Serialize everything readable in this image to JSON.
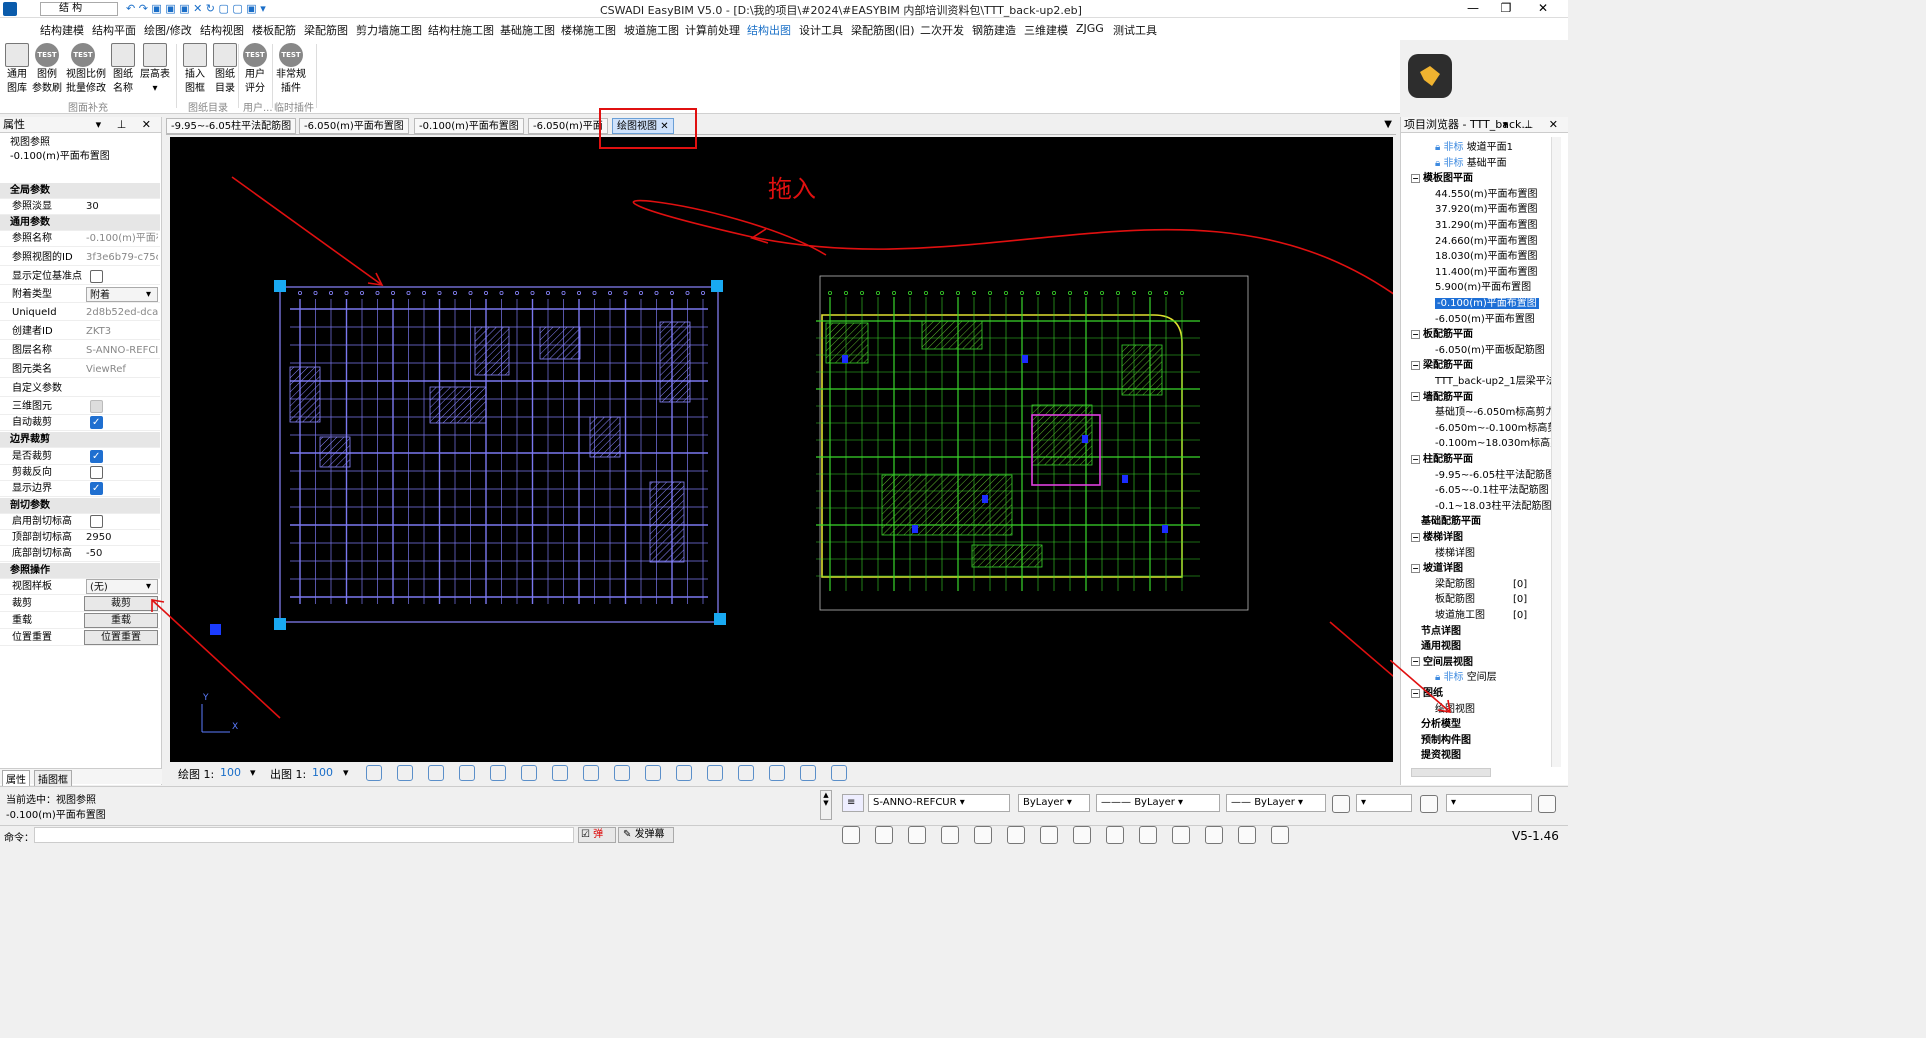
{
  "title_bar": {
    "workspace": "结 构",
    "title": "CSWADI EasyBIM V5.0 - [D:\\我的项目\\#2024\\#EASYBIM 内部培训资料包\\TTT_back-up2.eb]"
  },
  "menu": [
    "结构建模",
    "结构平面",
    "绘图/修改",
    "结构视图",
    "楼板配筋",
    "梁配筋图",
    "剪力墙施工图",
    "结构柱施工图",
    "基础施工图",
    "楼梯施工图",
    "坡道施工图",
    "计算前处理",
    "结构出图",
    "设计工具",
    "梁配筋图(旧)",
    "二次开发",
    "钢筋建造",
    "三维建模",
    "ZJGG",
    "测试工具"
  ],
  "menu_active": "结构出图",
  "ribbon": {
    "buttons": [
      {
        "l1": "通用",
        "l2": "图库"
      },
      {
        "l1": "图例",
        "l2": "参数刷",
        "icon": "TEST"
      },
      {
        "l1": "视图比例",
        "l2": "批量修改",
        "icon": "TEST"
      },
      {
        "l1": "图纸",
        "l2": "名称"
      },
      {
        "l1": "层高表",
        "l2": "▾"
      },
      {
        "l1": "插入",
        "l2": "图框"
      },
      {
        "l1": "图纸",
        "l2": "目录"
      },
      {
        "l1": "用户",
        "l2": "评分",
        "icon": "TEST"
      },
      {
        "l1": "非常规",
        "l2": "插件",
        "icon": "TEST"
      }
    ],
    "groups": [
      "图面补充",
      "图纸目录",
      "用户...",
      "临时插件"
    ]
  },
  "properties": {
    "header": "属性",
    "type_label": "视图参照",
    "type_value": "-0.100(m)平面布置图",
    "rows": [
      {
        "kind": "section",
        "k": "全局参数"
      },
      {
        "k": "参照淡显",
        "v": "30",
        "dark": true
      },
      {
        "kind": "section",
        "k": "通用参数"
      },
      {
        "k": "参照名称",
        "v": "-0.100(m)平面布"
      },
      {
        "k": "参照视图的ID",
        "v": "3f3e6b79-c75c"
      },
      {
        "k": "显示定位基准点",
        "cb": "off"
      },
      {
        "k": "附着类型",
        "v": "附着",
        "dark": true,
        "combo": true
      },
      {
        "k": "UniqueId",
        "v": "2d8b52ed-dca"
      },
      {
        "k": "创建者ID",
        "v": "ZKT3"
      },
      {
        "k": "图层名称",
        "v": "S-ANNO-REFCI"
      },
      {
        "k": "图元类名",
        "v": "ViewRef"
      },
      {
        "k": "自定义参数",
        "v": ""
      },
      {
        "k": "三维图元",
        "cb": "dis"
      },
      {
        "k": "自动裁剪",
        "cb": "on"
      },
      {
        "kind": "section",
        "k": "边界裁剪"
      },
      {
        "k": "是否裁剪",
        "cb": "on"
      },
      {
        "k": "剪裁反向",
        "cb": "off"
      },
      {
        "k": "显示边界",
        "cb": "on"
      },
      {
        "kind": "section",
        "k": "剖切参数"
      },
      {
        "k": "启用剖切标高",
        "cb": "off"
      },
      {
        "k": "顶部剖切标高",
        "v": "2950",
        "dark": true
      },
      {
        "k": "底部剖切标高",
        "v": "-50",
        "dark": true
      },
      {
        "kind": "section",
        "k": "参照操作"
      },
      {
        "k": "视图样板",
        "v": "(无)",
        "dark": true,
        "combo": true
      },
      {
        "k": "裁剪",
        "btn": "裁剪"
      },
      {
        "k": "重载",
        "btn": "重载"
      },
      {
        "k": "位置重置",
        "btn": "位置重置"
      }
    ],
    "tabs": [
      "属性",
      "插图框"
    ]
  },
  "doc_tabs": [
    "-9.95~-6.05柱平法配筋图",
    "-6.050(m)平面布置图",
    "-0.100(m)平面布置图",
    "-6.050(m)平面",
    "绘图视图"
  ],
  "doc_tab_active": "绘图视图",
  "annotation": "拖入",
  "axis": {
    "y": "Y",
    "x": "X"
  },
  "canvas_status": {
    "draw_label": "绘图 1:",
    "draw_scale": "100",
    "out_label": "出图 1:",
    "out_scale": "100"
  },
  "browser": {
    "header": "项目浏览器 - TTT_back...",
    "items": [
      {
        "t": "坡道平面1",
        "lock": "非标",
        "indent": 2
      },
      {
        "t": "基础平面",
        "lock": "非标",
        "indent": 2
      },
      {
        "t": "模板图平面",
        "bold": true,
        "indent": 0
      },
      {
        "t": "44.550(m)平面布置图",
        "indent": 2
      },
      {
        "t": "37.920(m)平面布置图",
        "indent": 2
      },
      {
        "t": "31.290(m)平面布置图",
        "indent": 2
      },
      {
        "t": "24.660(m)平面布置图",
        "indent": 2
      },
      {
        "t": "18.030(m)平面布置图",
        "indent": 2
      },
      {
        "t": "11.400(m)平面布置图",
        "indent": 2
      },
      {
        "t": "5.900(m)平面布置图",
        "indent": 2
      },
      {
        "t": "-0.100(m)平面布置图",
        "indent": 2,
        "sel": true
      },
      {
        "t": "-6.050(m)平面布置图",
        "indent": 2
      },
      {
        "t": "板配筋平面",
        "bold": true,
        "indent": 0
      },
      {
        "t": "-6.050(m)平面板配筋图",
        "indent": 2
      },
      {
        "t": "梁配筋平面",
        "bold": true,
        "indent": 0
      },
      {
        "t": "TTT_back-up2_1层梁平法",
        "indent": 2
      },
      {
        "t": "墙配筋平面",
        "bold": true,
        "indent": 0
      },
      {
        "t": "基础顶~-6.050m标高剪力",
        "indent": 2
      },
      {
        "t": "-6.050m~-0.100m标高剪",
        "indent": 2
      },
      {
        "t": "-0.100m~18.030m标高剪",
        "indent": 2
      },
      {
        "t": "柱配筋平面",
        "bold": true,
        "indent": 0
      },
      {
        "t": "-9.95~-6.05柱平法配筋图",
        "indent": 2
      },
      {
        "t": "-6.05~-0.1柱平法配筋图",
        "indent": 2
      },
      {
        "t": "-0.1~18.03柱平法配筋图",
        "indent": 2
      },
      {
        "t": "基础配筋平面",
        "bold": true,
        "indent": 1
      },
      {
        "t": "楼梯详图",
        "bold": true,
        "indent": 0
      },
      {
        "t": "楼梯详图",
        "indent": 2
      },
      {
        "t": "坡道详图",
        "bold": true,
        "indent": 0
      },
      {
        "t": "梁配筋图",
        "indent": 2,
        "count": "[0]"
      },
      {
        "t": "板配筋图",
        "indent": 2,
        "count": "[0]"
      },
      {
        "t": "坡道施工图",
        "indent": 2,
        "count": "[0]"
      },
      {
        "t": "节点详图",
        "bold": true,
        "indent": 1
      },
      {
        "t": "通用视图",
        "bold": true,
        "indent": 1
      },
      {
        "t": "空间层视图",
        "bold": true,
        "indent": 0
      },
      {
        "t": "空间层",
        "lock": "非标",
        "indent": 2
      },
      {
        "t": "图纸",
        "bold": true,
        "indent": 0
      },
      {
        "t": "绘图视图",
        "indent": 2
      },
      {
        "t": "分析模型",
        "bold": true,
        "indent": 1
      },
      {
        "t": "预制构件图",
        "bold": true,
        "indent": 1
      },
      {
        "t": "提资视图",
        "bold": true,
        "indent": 1
      }
    ]
  },
  "bottom": {
    "current": "当前选中：视图参照",
    "current2": "-0.100(m)平面布置图",
    "command": "命令：",
    "layer": "S-ANNO-REFCUR",
    "color": "ByLayer",
    "linetype": "ByLayer",
    "lineweight": "ByLayer",
    "popup": "弹",
    "barrage": "发弹幕",
    "version": "V5-1.46"
  },
  "colors": {
    "accent": "#1a70c7",
    "selection": "#1d6fd6",
    "annotation": "#e01010",
    "plan_left": "#8a86ff",
    "plan_right": "#39d62b"
  }
}
